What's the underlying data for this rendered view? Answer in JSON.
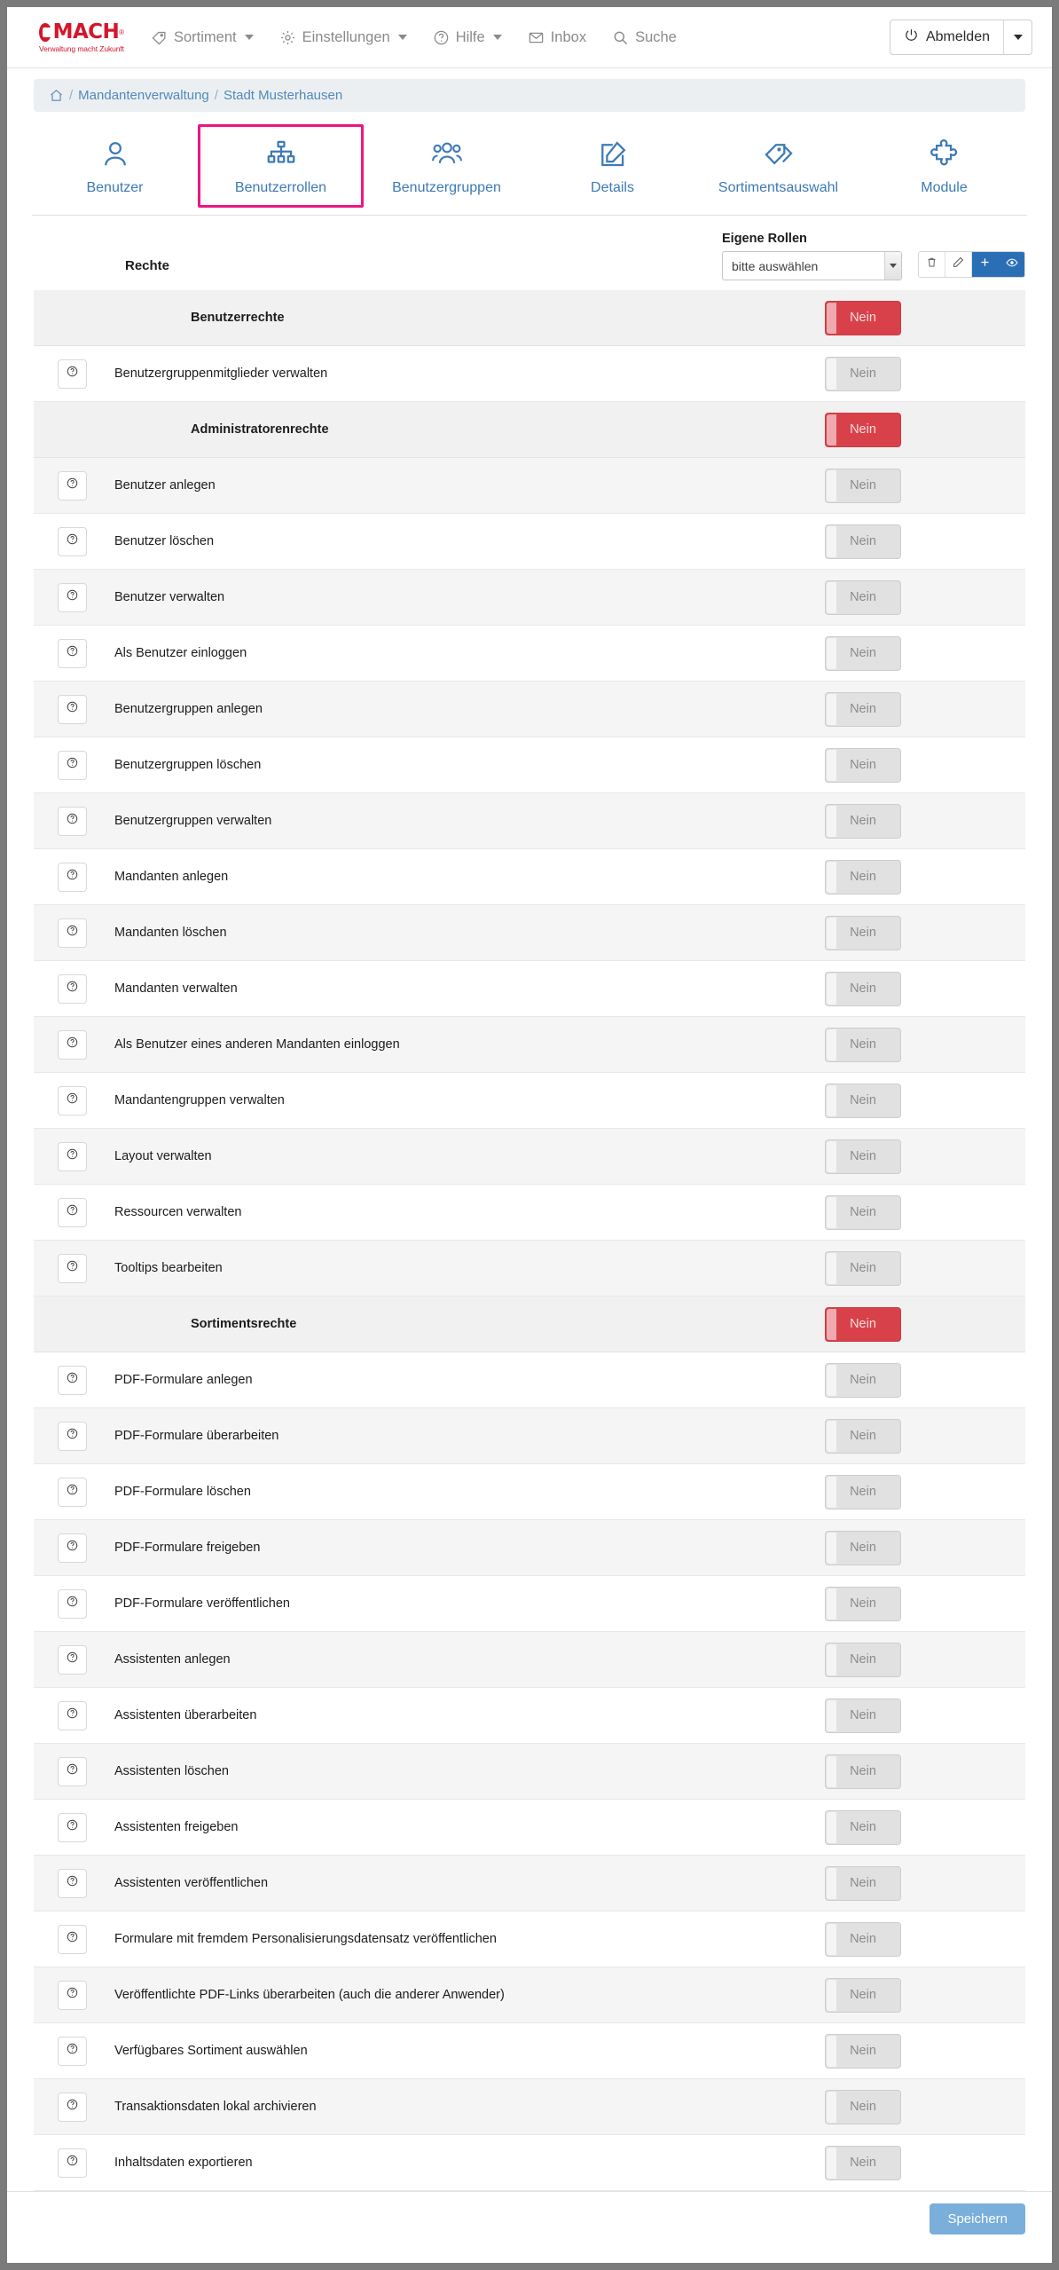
{
  "header": {
    "logo": {
      "word": "MACH",
      "reg": "®",
      "tagline": "Verwaltung macht Zukunft"
    },
    "nav": [
      {
        "label": "Sortiment",
        "icon": "tag-icon",
        "caret": true
      },
      {
        "label": "Einstellungen",
        "icon": "gear-icon",
        "caret": true
      },
      {
        "label": "Hilfe",
        "icon": "question-circle-icon",
        "caret": true
      },
      {
        "label": "Inbox",
        "icon": "envelope-icon",
        "caret": false
      },
      {
        "label": "Suche",
        "icon": "search-icon",
        "caret": false
      }
    ],
    "logout_label": "Abmelden",
    "logout_icon": "power-icon",
    "logout_caret_icon": "chevron-down-icon"
  },
  "breadcrumb": {
    "home_icon": "home-icon",
    "separator": "/",
    "items": [
      "Mandantenverwaltung",
      "Stadt Musterhausen"
    ]
  },
  "tabs": [
    {
      "label": "Benutzer",
      "icon": "user-icon",
      "selected": false
    },
    {
      "label": "Benutzerrollen",
      "icon": "org-chart-icon",
      "selected": true
    },
    {
      "label": "Benutzergruppen",
      "icon": "users-group-icon",
      "selected": false
    },
    {
      "label": "Details",
      "icon": "edit-square-icon",
      "selected": false
    },
    {
      "label": "Sortimentsauswahl",
      "icon": "tags-icon",
      "selected": false
    },
    {
      "label": "Module",
      "icon": "puzzle-icon",
      "selected": false
    }
  ],
  "rights_panel": {
    "title": "Rechte",
    "own_roles_label": "Eigene Rollen",
    "select_value": "bitte auswählen",
    "select_arrow_icon": "chevron-down-icon",
    "actions": [
      {
        "name": "delete-role-button",
        "icon": "trash-icon",
        "style": "light"
      },
      {
        "name": "edit-role-button",
        "icon": "pencil-icon",
        "style": "light"
      },
      {
        "name": "add-role-button",
        "icon": "plus-icon",
        "style": "blue"
      },
      {
        "name": "view-role-button",
        "icon": "eye-icon",
        "style": "blue"
      }
    ]
  },
  "toggle_labels": {
    "off": "Nein"
  },
  "rows": [
    {
      "type": "group",
      "label": "Benutzerrechte",
      "value": "Nein",
      "state": "red"
    },
    {
      "type": "item",
      "label": "Benutzergruppenmitglieder verwalten",
      "value": "Nein",
      "state": "off"
    },
    {
      "type": "group",
      "label": "Administratorenrechte",
      "value": "Nein",
      "state": "red"
    },
    {
      "type": "item",
      "label": "Benutzer anlegen",
      "value": "Nein",
      "state": "off"
    },
    {
      "type": "item",
      "label": "Benutzer löschen",
      "value": "Nein",
      "state": "off"
    },
    {
      "type": "item",
      "label": "Benutzer verwalten",
      "value": "Nein",
      "state": "off"
    },
    {
      "type": "item",
      "label": "Als Benutzer einloggen",
      "value": "Nein",
      "state": "off"
    },
    {
      "type": "item",
      "label": "Benutzergruppen anlegen",
      "value": "Nein",
      "state": "off"
    },
    {
      "type": "item",
      "label": "Benutzergruppen löschen",
      "value": "Nein",
      "state": "off"
    },
    {
      "type": "item",
      "label": "Benutzergruppen verwalten",
      "value": "Nein",
      "state": "off"
    },
    {
      "type": "item",
      "label": "Mandanten anlegen",
      "value": "Nein",
      "state": "off"
    },
    {
      "type": "item",
      "label": "Mandanten löschen",
      "value": "Nein",
      "state": "off"
    },
    {
      "type": "item",
      "label": "Mandanten verwalten",
      "value": "Nein",
      "state": "off"
    },
    {
      "type": "item",
      "label": "Als Benutzer eines anderen Mandanten einloggen",
      "value": "Nein",
      "state": "off"
    },
    {
      "type": "item",
      "label": "Mandantengruppen verwalten",
      "value": "Nein",
      "state": "off"
    },
    {
      "type": "item",
      "label": "Layout verwalten",
      "value": "Nein",
      "state": "off"
    },
    {
      "type": "item",
      "label": "Ressourcen verwalten",
      "value": "Nein",
      "state": "off"
    },
    {
      "type": "item",
      "label": "Tooltips bearbeiten",
      "value": "Nein",
      "state": "off"
    },
    {
      "type": "group",
      "label": "Sortimentsrechte",
      "value": "Nein",
      "state": "red"
    },
    {
      "type": "item",
      "label": "PDF-Formulare anlegen",
      "value": "Nein",
      "state": "off"
    },
    {
      "type": "item",
      "label": "PDF-Formulare überarbeiten",
      "value": "Nein",
      "state": "off"
    },
    {
      "type": "item",
      "label": "PDF-Formulare löschen",
      "value": "Nein",
      "state": "off"
    },
    {
      "type": "item",
      "label": "PDF-Formulare freigeben",
      "value": "Nein",
      "state": "off"
    },
    {
      "type": "item",
      "label": "PDF-Formulare veröffentlichen",
      "value": "Nein",
      "state": "off"
    },
    {
      "type": "item",
      "label": "Assistenten anlegen",
      "value": "Nein",
      "state": "off"
    },
    {
      "type": "item",
      "label": "Assistenten überarbeiten",
      "value": "Nein",
      "state": "off"
    },
    {
      "type": "item",
      "label": "Assistenten löschen",
      "value": "Nein",
      "state": "off"
    },
    {
      "type": "item",
      "label": "Assistenten freigeben",
      "value": "Nein",
      "state": "off"
    },
    {
      "type": "item",
      "label": "Assistenten veröffentlichen",
      "value": "Nein",
      "state": "off"
    },
    {
      "type": "item",
      "label": "Formulare mit fremdem Personalisierungsdatensatz veröffentlichen",
      "value": "Nein",
      "state": "off"
    },
    {
      "type": "item",
      "label": "Veröffentlichte PDF-Links überarbeiten (auch die anderer Anwender)",
      "value": "Nein",
      "state": "off"
    },
    {
      "type": "item",
      "label": "Verfügbares Sortiment auswählen",
      "value": "Nein",
      "state": "off"
    },
    {
      "type": "item",
      "label": "Transaktionsdaten lokal archivieren",
      "value": "Nein",
      "state": "off"
    },
    {
      "type": "item",
      "label": "Inhaltsdaten exportieren",
      "value": "Nein",
      "state": "off"
    }
  ],
  "footer": {
    "save_label": "Speichern"
  },
  "colors": {
    "brand_red": "#d4162c",
    "accent_blue": "#3d7ab5",
    "highlight_pink": "#ec1683",
    "toggle_red": "#d9414a",
    "save_blue": "#7aaedb"
  }
}
